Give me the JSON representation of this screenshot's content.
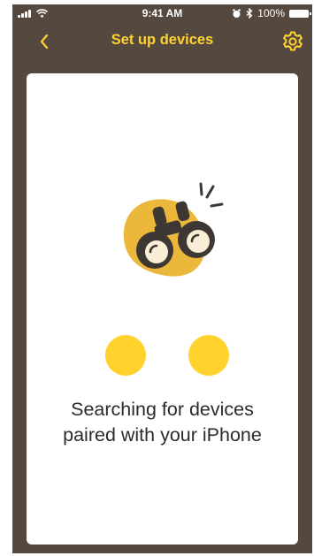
{
  "status_bar": {
    "time": "9:41 AM",
    "battery": "100%"
  },
  "nav": {
    "title": "Set up devices",
    "back_icon": "chevron-left-icon",
    "settings_icon": "gear-icon"
  },
  "main": {
    "message_line_1": "Searching for devices",
    "message_line_2": "paired with your iPhone"
  },
  "colors": {
    "background": "#55493f",
    "accent": "#ffd22e",
    "card": "#ffffff",
    "text": "#2b2b2b"
  }
}
